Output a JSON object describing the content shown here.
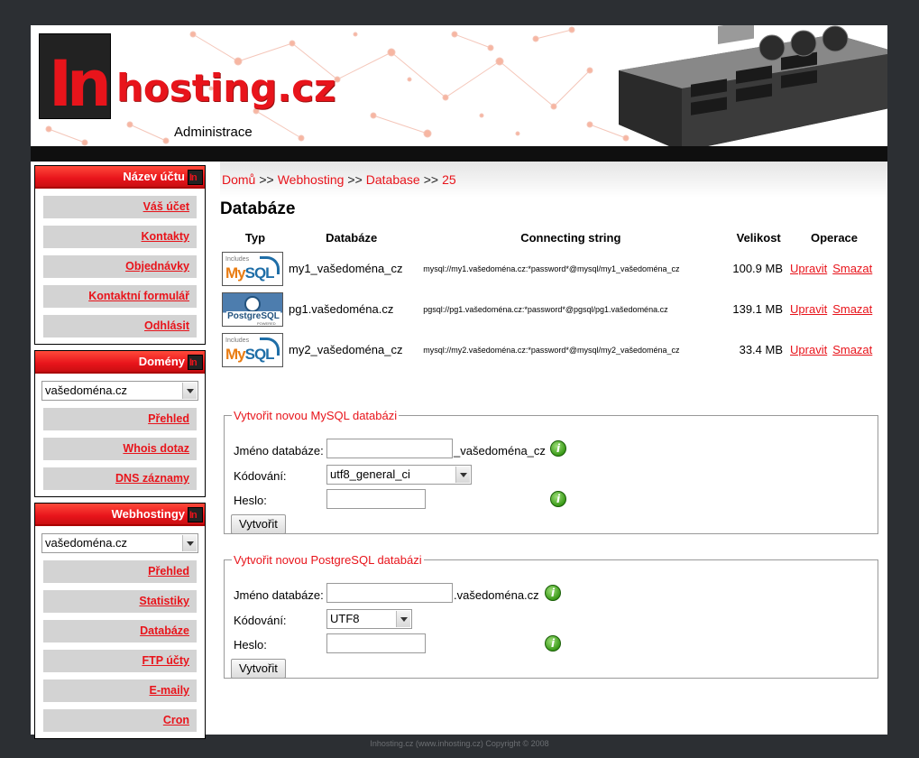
{
  "header": {
    "logo_in": "In",
    "logo_text": "hosting.cz",
    "subtitle": "Administrace"
  },
  "sidebar": {
    "account": {
      "title": "Název účtu",
      "items": [
        "Váš účet",
        "Kontakty",
        "Objednávky",
        "Kontaktní formulář",
        "Odhlásit"
      ]
    },
    "domains": {
      "title": "Domény",
      "selected": "vašedoména.cz",
      "items": [
        "Přehled",
        "Whois dotaz",
        "DNS záznamy"
      ]
    },
    "webhosting": {
      "title": "Webhostingy",
      "selected": "vašedoména.cz",
      "items": [
        "Přehled",
        "Statistiky",
        "Databáze",
        "FTP účty",
        "E-maily",
        "Cron"
      ]
    }
  },
  "breadcrumb": {
    "items": [
      "Domů",
      "Webhosting",
      "Database",
      "25"
    ],
    "sep": ">>"
  },
  "page_title": "Databáze",
  "table": {
    "headers": [
      "Typ",
      "Databáze",
      "Connecting string",
      "Velikost",
      "Operace"
    ],
    "rows": [
      {
        "type": "MySQL",
        "name": "my1_vašedoména_cz",
        "conn": "mysql://my1.vašedoména.cz:*password*@mysql/my1_vašedoména_cz",
        "size": "100.9 MB"
      },
      {
        "type": "PostgreSQL",
        "name": "pg1.vašedoména.cz",
        "conn": "pgsql://pg1.vašedoména.cz:*password*@pgsql/pg1.vašedoména.cz",
        "size": "139.1 MB"
      },
      {
        "type": "MySQL",
        "name": "my2_vašedoména_cz",
        "conn": "mysql://my2.vašedoména.cz:*password*@mysql/my2_vašedoména_cz",
        "size": "33.4 MB"
      }
    ],
    "edit_label": "Upravit",
    "delete_label": "Smazat",
    "mysql_badge": {
      "includes": "Includes",
      "name_a": "My",
      "name_b": "SQL"
    },
    "pg_badge": {
      "name": "PostgreSQL",
      "powered": "POWERED"
    }
  },
  "mysql_form": {
    "legend": "Vytvořit novou MySQL databázi",
    "name_label": "Jméno databáze:",
    "name_value": "",
    "suffix": "_vašedoména_cz",
    "encoding_label": "Kódování:",
    "encoding_value": "utf8_general_ci",
    "password_label": "Heslo:",
    "password_value": "",
    "submit": "Vytvořit"
  },
  "pgsql_form": {
    "legend": "Vytvořit novou PostgreSQL databázi",
    "name_label": "Jméno databáze:",
    "name_value": "",
    "suffix": ".vašedoména.cz",
    "encoding_label": "Kódování:",
    "encoding_value": "UTF8",
    "password_label": "Heslo:",
    "password_value": "",
    "submit": "Vytvořit"
  },
  "info_icon_glyph": "i",
  "footer": "Inhosting.cz (www.inhosting.cz) Copyright © 2008",
  "colors": {
    "accent": "#e8141b",
    "background": "#2c2f33",
    "nav_bg": "#d3d3d3"
  }
}
